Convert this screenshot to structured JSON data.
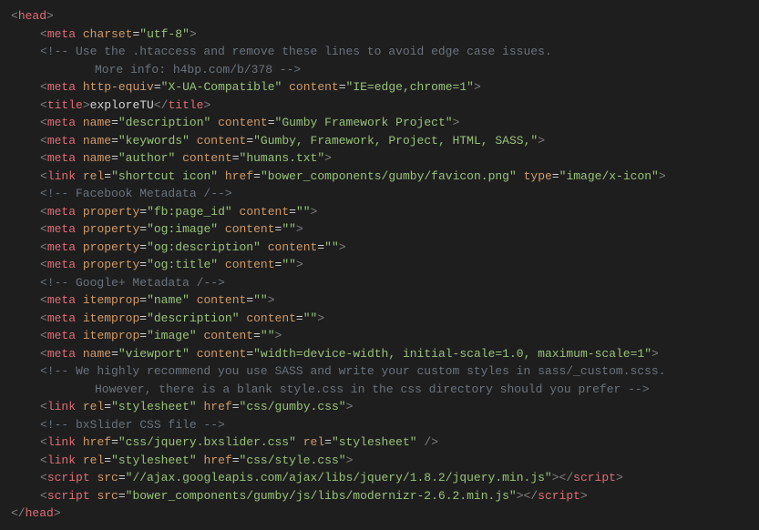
{
  "lines": [
    {
      "indent": 0,
      "type": "open-tag",
      "tag": "head"
    },
    {
      "indent": 1,
      "type": "self-tag",
      "tag": "meta",
      "attrs": [
        [
          "charset",
          "utf-8"
        ]
      ]
    },
    {
      "indent": 1,
      "type": "comment",
      "text": "<!-- Use the .htaccess and remove these lines to avoid edge case issues."
    },
    {
      "indent": 2,
      "type": "comment",
      "text": "More info: h4bp.com/b/378 -->"
    },
    {
      "indent": 1,
      "type": "self-tag",
      "tag": "meta",
      "attrs": [
        [
          "http-equiv",
          "X-UA-Compatible"
        ],
        [
          "content",
          "IE=edge,chrome=1"
        ]
      ]
    },
    {
      "indent": 1,
      "type": "wrap-tag",
      "tag": "title",
      "inner": "exploreTU"
    },
    {
      "indent": 1,
      "type": "self-tag",
      "tag": "meta",
      "attrs": [
        [
          "name",
          "description"
        ],
        [
          "content",
          "Gumby Framework Project"
        ]
      ]
    },
    {
      "indent": 1,
      "type": "self-tag",
      "tag": "meta",
      "attrs": [
        [
          "name",
          "keywords"
        ],
        [
          "content",
          "Gumby, Framework, Project, HTML, SASS,"
        ]
      ]
    },
    {
      "indent": 1,
      "type": "self-tag",
      "tag": "meta",
      "attrs": [
        [
          "name",
          "author"
        ],
        [
          "content",
          "humans.txt"
        ]
      ]
    },
    {
      "indent": 1,
      "type": "self-tag",
      "tag": "link",
      "attrs": [
        [
          "rel",
          "shortcut icon"
        ],
        [
          "href",
          "bower_components/gumby/favicon.png"
        ],
        [
          "type",
          "image/x-icon"
        ]
      ]
    },
    {
      "indent": 1,
      "type": "comment",
      "text": "<!-- Facebook Metadata /-->"
    },
    {
      "indent": 1,
      "type": "self-tag",
      "tag": "meta",
      "attrs": [
        [
          "property",
          "fb:page_id"
        ],
        [
          "content",
          ""
        ]
      ]
    },
    {
      "indent": 1,
      "type": "self-tag",
      "tag": "meta",
      "attrs": [
        [
          "property",
          "og:image"
        ],
        [
          "content",
          ""
        ]
      ]
    },
    {
      "indent": 1,
      "type": "self-tag",
      "tag": "meta",
      "attrs": [
        [
          "property",
          "og:description"
        ],
        [
          "content",
          ""
        ]
      ]
    },
    {
      "indent": 1,
      "type": "self-tag",
      "tag": "meta",
      "attrs": [
        [
          "property",
          "og:title"
        ],
        [
          "content",
          ""
        ]
      ]
    },
    {
      "indent": 1,
      "type": "comment",
      "text": "<!-- Google+ Metadata /-->"
    },
    {
      "indent": 1,
      "type": "self-tag",
      "tag": "meta",
      "attrs": [
        [
          "itemprop",
          "name"
        ],
        [
          "content",
          ""
        ]
      ]
    },
    {
      "indent": 1,
      "type": "self-tag",
      "tag": "meta",
      "attrs": [
        [
          "itemprop",
          "description"
        ],
        [
          "content",
          ""
        ]
      ]
    },
    {
      "indent": 1,
      "type": "self-tag",
      "tag": "meta",
      "attrs": [
        [
          "itemprop",
          "image"
        ],
        [
          "content",
          ""
        ]
      ]
    },
    {
      "indent": 1,
      "type": "self-tag",
      "tag": "meta",
      "attrs": [
        [
          "name",
          "viewport"
        ],
        [
          "content",
          "width=device-width, initial-scale=1.0, maximum-scale=1"
        ]
      ]
    },
    {
      "indent": 1,
      "type": "comment",
      "text": "<!-- We highly recommend you use SASS and write your custom styles in sass/_custom.scss."
    },
    {
      "indent": 2,
      "type": "comment",
      "text": "However, there is a blank style.css in the css directory should you prefer -->"
    },
    {
      "indent": 1,
      "type": "self-tag",
      "tag": "link",
      "attrs": [
        [
          "rel",
          "stylesheet"
        ],
        [
          "href",
          "css/gumby.css"
        ]
      ]
    },
    {
      "indent": 1,
      "type": "comment",
      "text": "<!-- bxSlider CSS file -->"
    },
    {
      "indent": 1,
      "type": "self-tag",
      "tag": "link",
      "attrs": [
        [
          "href",
          "css/jquery.bxslider.css"
        ],
        [
          "rel",
          "stylesheet"
        ]
      ],
      "trailing": " /"
    },
    {
      "indent": 1,
      "type": "self-tag",
      "tag": "link",
      "attrs": [
        [
          "rel",
          "stylesheet"
        ],
        [
          "href",
          "css/style.css"
        ]
      ]
    },
    {
      "indent": 1,
      "type": "wrap-tag",
      "tag": "script",
      "attrs": [
        [
          "src",
          "//ajax.googleapis.com/ajax/libs/jquery/1.8.2/jquery.min.js"
        ]
      ],
      "inner": ""
    },
    {
      "indent": 1,
      "type": "wrap-tag",
      "tag": "script",
      "attrs": [
        [
          "src",
          "bower_components/gumby/js/libs/modernizr-2.6.2.min.js"
        ]
      ],
      "inner": ""
    },
    {
      "indent": 0,
      "type": "close-tag",
      "tag": "head"
    }
  ]
}
